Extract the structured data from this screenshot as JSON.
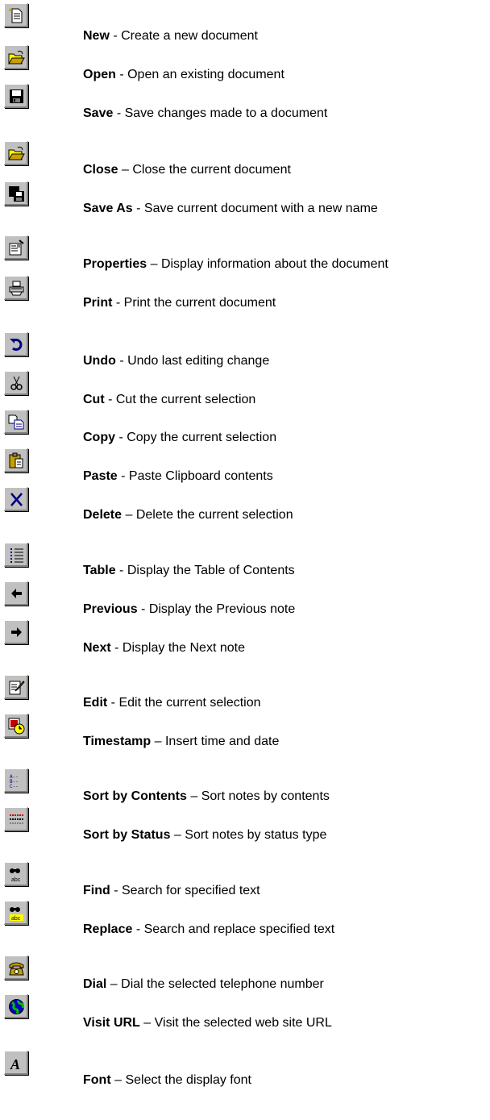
{
  "items": [
    {
      "name": "New",
      "sep": " - ",
      "desc": "Create a new document",
      "icon": "new-document-icon"
    },
    {
      "name": "Open",
      "sep": " - ",
      "desc": "Open an existing document",
      "icon": "open-folder-icon"
    },
    {
      "name": "Save",
      "sep": " - ",
      "desc": "Save changes made to a document",
      "icon": "save-floppy-icon"
    },
    {
      "name": "Close",
      "sep": " – ",
      "desc": "Close the current document",
      "icon": "close-folder-icon"
    },
    {
      "name": "Save As",
      "sep": " - ",
      "desc": "Save current document with a new name",
      "icon": "save-as-icon"
    },
    {
      "name": "Properties",
      "sep": " – ",
      "desc": "Display information about the document",
      "icon": "properties-icon"
    },
    {
      "name": "Print",
      "sep": " - ",
      "desc": "Print the current document",
      "icon": "printer-icon"
    },
    {
      "name": "Undo",
      "sep": " - ",
      "desc": "Undo last editing change",
      "icon": "undo-icon"
    },
    {
      "name": "Cut",
      "sep": " - ",
      "desc": "Cut the current selection",
      "icon": "scissors-icon"
    },
    {
      "name": "Copy",
      "sep": " - ",
      "desc": "Copy the current selection",
      "icon": "copy-icon"
    },
    {
      "name": "Paste",
      "sep": " - ",
      "desc": "Paste Clipboard contents",
      "icon": "paste-clipboard-icon"
    },
    {
      "name": "Delete",
      "sep": " – ",
      "desc": "Delete the current selection",
      "icon": "delete-x-icon"
    },
    {
      "name": "Table",
      "sep": " - ",
      "desc": "Display the Table of Contents",
      "icon": "table-of-contents-icon"
    },
    {
      "name": "Previous",
      "sep": " - ",
      "desc": "Display the Previous note",
      "icon": "arrow-left-icon"
    },
    {
      "name": "Next",
      "sep": " - ",
      "desc": "Display the Next note",
      "icon": "arrow-right-icon"
    },
    {
      "name": "Edit",
      "sep": " - ",
      "desc": "Edit the current selection",
      "icon": "edit-pencil-icon"
    },
    {
      "name": "Timestamp",
      "sep": " – ",
      "desc": "Insert time and date",
      "icon": "timestamp-clock-icon"
    },
    {
      "name": "Sort by Contents",
      "sep": " – ",
      "desc": "Sort notes by contents",
      "icon": "sort-by-contents-icon"
    },
    {
      "name": "Sort by Status",
      "sep": " – ",
      "desc": "Sort notes by status type",
      "icon": "sort-by-status-icon"
    },
    {
      "name": "Find",
      "sep": " - ",
      "desc": "Search for specified text",
      "icon": "find-binoculars-icon"
    },
    {
      "name": "Replace",
      "sep": " - ",
      "desc": "Search and replace specified text",
      "icon": "replace-binoculars-icon"
    },
    {
      "name": "Dial",
      "sep": " – ",
      "desc": "Dial the selected telephone number",
      "icon": "telephone-icon"
    },
    {
      "name": "Visit URL",
      "sep": " – ",
      "desc": "Visit the selected web site URL",
      "icon": "globe-icon"
    },
    {
      "name": "Font",
      "sep": " – ",
      "desc": "Select the display font",
      "icon": "font-letter-a-icon"
    }
  ]
}
